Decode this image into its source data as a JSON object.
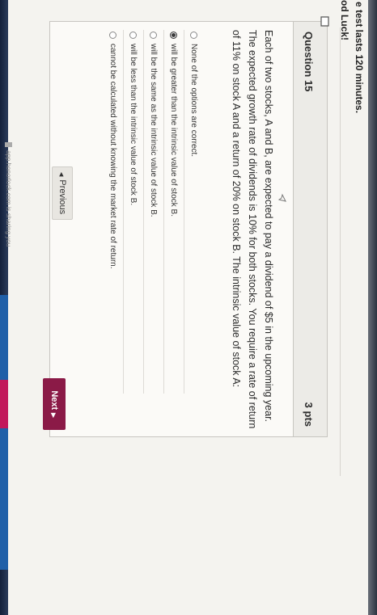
{
  "header": {
    "quiz_note": "e test lasts 120 minutes.",
    "good_luck": "od Luck!"
  },
  "question": {
    "title": "Question 15",
    "points": "3 pts",
    "text": "Each of two stocks, A and B, are expected to pay a dividend of $5 in the upcoming year. The expected growth rate of dividends is 10% for both stocks. You require a rate of return of 11% on stock A and a return of 20% on stock B. The intrinsic value of stock A:",
    "options": [
      {
        "label": "None of the options are correct.",
        "selected": false
      },
      {
        "label": "will be greater than the intrinsic value of stock B.",
        "selected": true
      },
      {
        "label": "will be the same as the intrinsic value of stock B.",
        "selected": false
      },
      {
        "label": "will be less than the intrinsic value of stock B.",
        "selected": false
      },
      {
        "label": "cannot be calculated without knowing the market rate of return.",
        "selected": false
      }
    ]
  },
  "nav": {
    "previous_label": "Previous",
    "next_label": "Next"
  },
  "banner": {
    "text": "app.honorlock.com is sharing you"
  },
  "colors": {
    "next_button": "#8b1a47",
    "taskbar_blue": "#1f5fa8"
  }
}
